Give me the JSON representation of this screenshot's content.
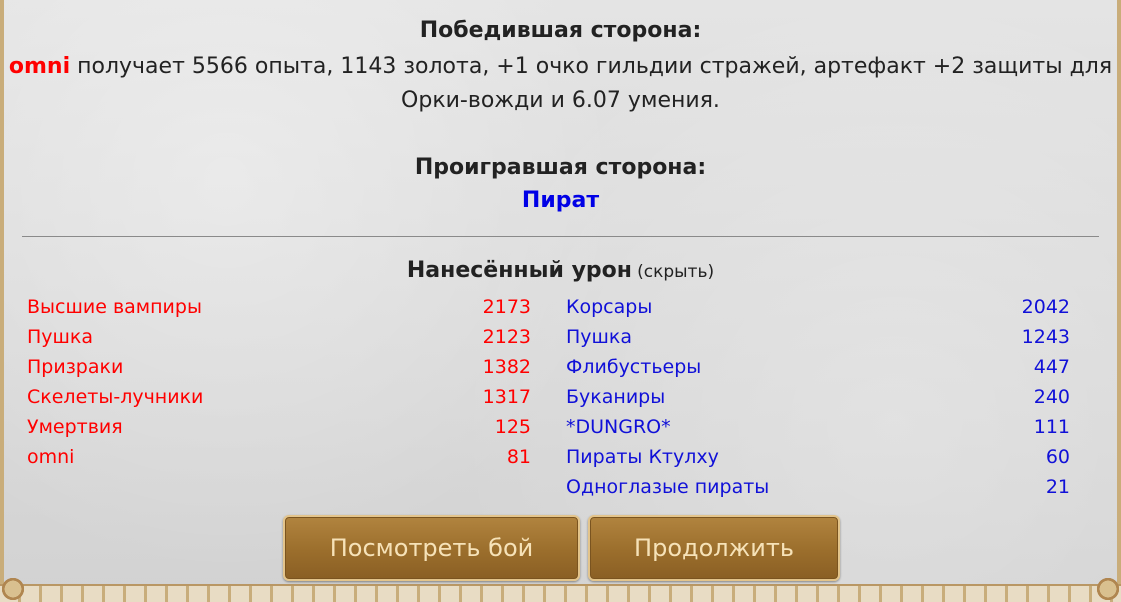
{
  "winner": {
    "heading": "Победившая сторона:",
    "player": "omni",
    "reward_line1": " получает 5566 опыта, 1143 золота, +1 очко гильдии стражей, артефакт +2 защиты для",
    "reward_line2": "Орки-вожди и 6.07 умения."
  },
  "loser": {
    "heading": "Проигравшая сторона:",
    "player": "Пират"
  },
  "damage": {
    "title": "Нанесённый урон",
    "hide_link": "(скрыть)",
    "left": [
      {
        "name": "Высшие вампиры",
        "value": "2173"
      },
      {
        "name": "Пушка",
        "value": "2123"
      },
      {
        "name": "Призраки",
        "value": "1382"
      },
      {
        "name": "Скелеты-лучники",
        "value": "1317"
      },
      {
        "name": "Умертвия",
        "value": "125"
      },
      {
        "name": "omni",
        "value": "81"
      }
    ],
    "right": [
      {
        "name": "Корсары",
        "value": "2042"
      },
      {
        "name": "Пушка",
        "value": "1243"
      },
      {
        "name": "Флибустьеры",
        "value": "447"
      },
      {
        "name": "Буканиры",
        "value": "240"
      },
      {
        "name": "*DUNGRO*",
        "value": "111"
      },
      {
        "name": "Пираты Ктулху",
        "value": "60"
      },
      {
        "name": "Одноглазые пираты",
        "value": "21"
      }
    ]
  },
  "buttons": {
    "view_battle": "Посмотреть бой",
    "continue": "Продолжить"
  },
  "colors": {
    "winner": "#ff0000",
    "loser": "#0000e6",
    "button": "#9b6e2c"
  }
}
